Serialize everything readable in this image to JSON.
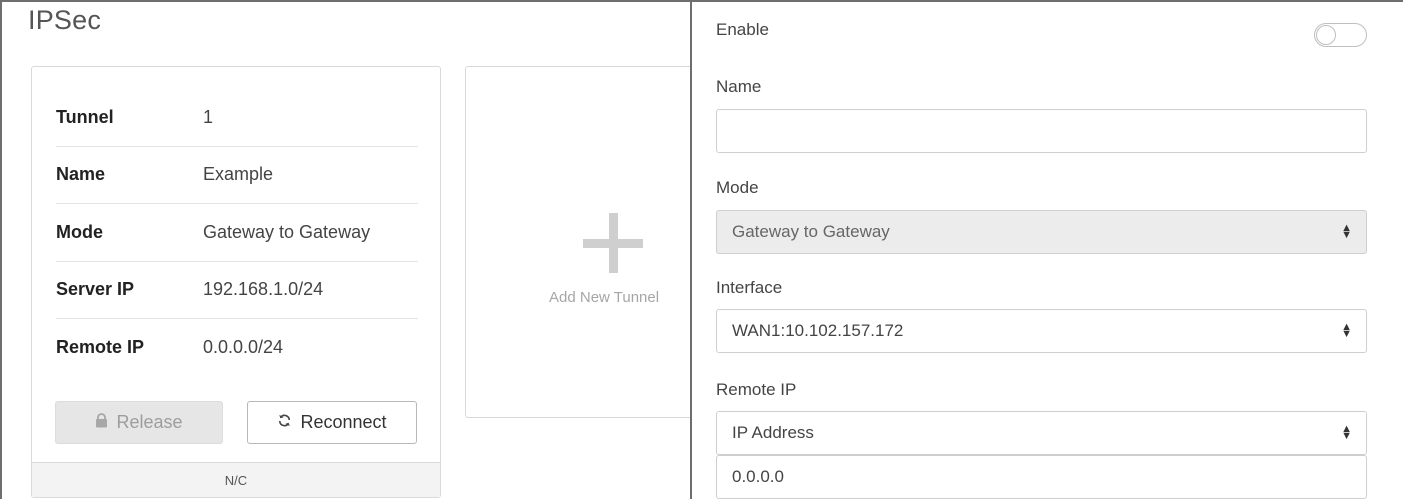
{
  "page": {
    "title": "IPSec"
  },
  "tunnel_card": {
    "rows": [
      {
        "label": "Tunnel",
        "value": "1"
      },
      {
        "label": "Name",
        "value": "Example"
      },
      {
        "label": "Mode",
        "value": "Gateway to Gateway"
      },
      {
        "label": "Server IP",
        "value": "192.168.1.0/24"
      },
      {
        "label": "Remote IP",
        "value": "0.0.0.0/24"
      }
    ],
    "release_label": "Release",
    "reconnect_label": "Reconnect",
    "status": "N/C"
  },
  "add_card": {
    "label": "Add New Tunnel"
  },
  "form": {
    "enable_label": "Enable",
    "enable_on": false,
    "name_label": "Name",
    "name_value": "",
    "mode_label": "Mode",
    "mode_value": "Gateway to Gateway",
    "interface_label": "Interface",
    "interface_value": "WAN1:10.102.157.172",
    "remote_ip_label": "Remote IP",
    "remote_ip_type": "IP Address",
    "remote_ip_value": "0.0.0.0"
  },
  "icons": {
    "release": "lock-icon",
    "reconnect": "refresh-icon",
    "add": "plus-icon",
    "select": "sort-arrows-icon"
  }
}
